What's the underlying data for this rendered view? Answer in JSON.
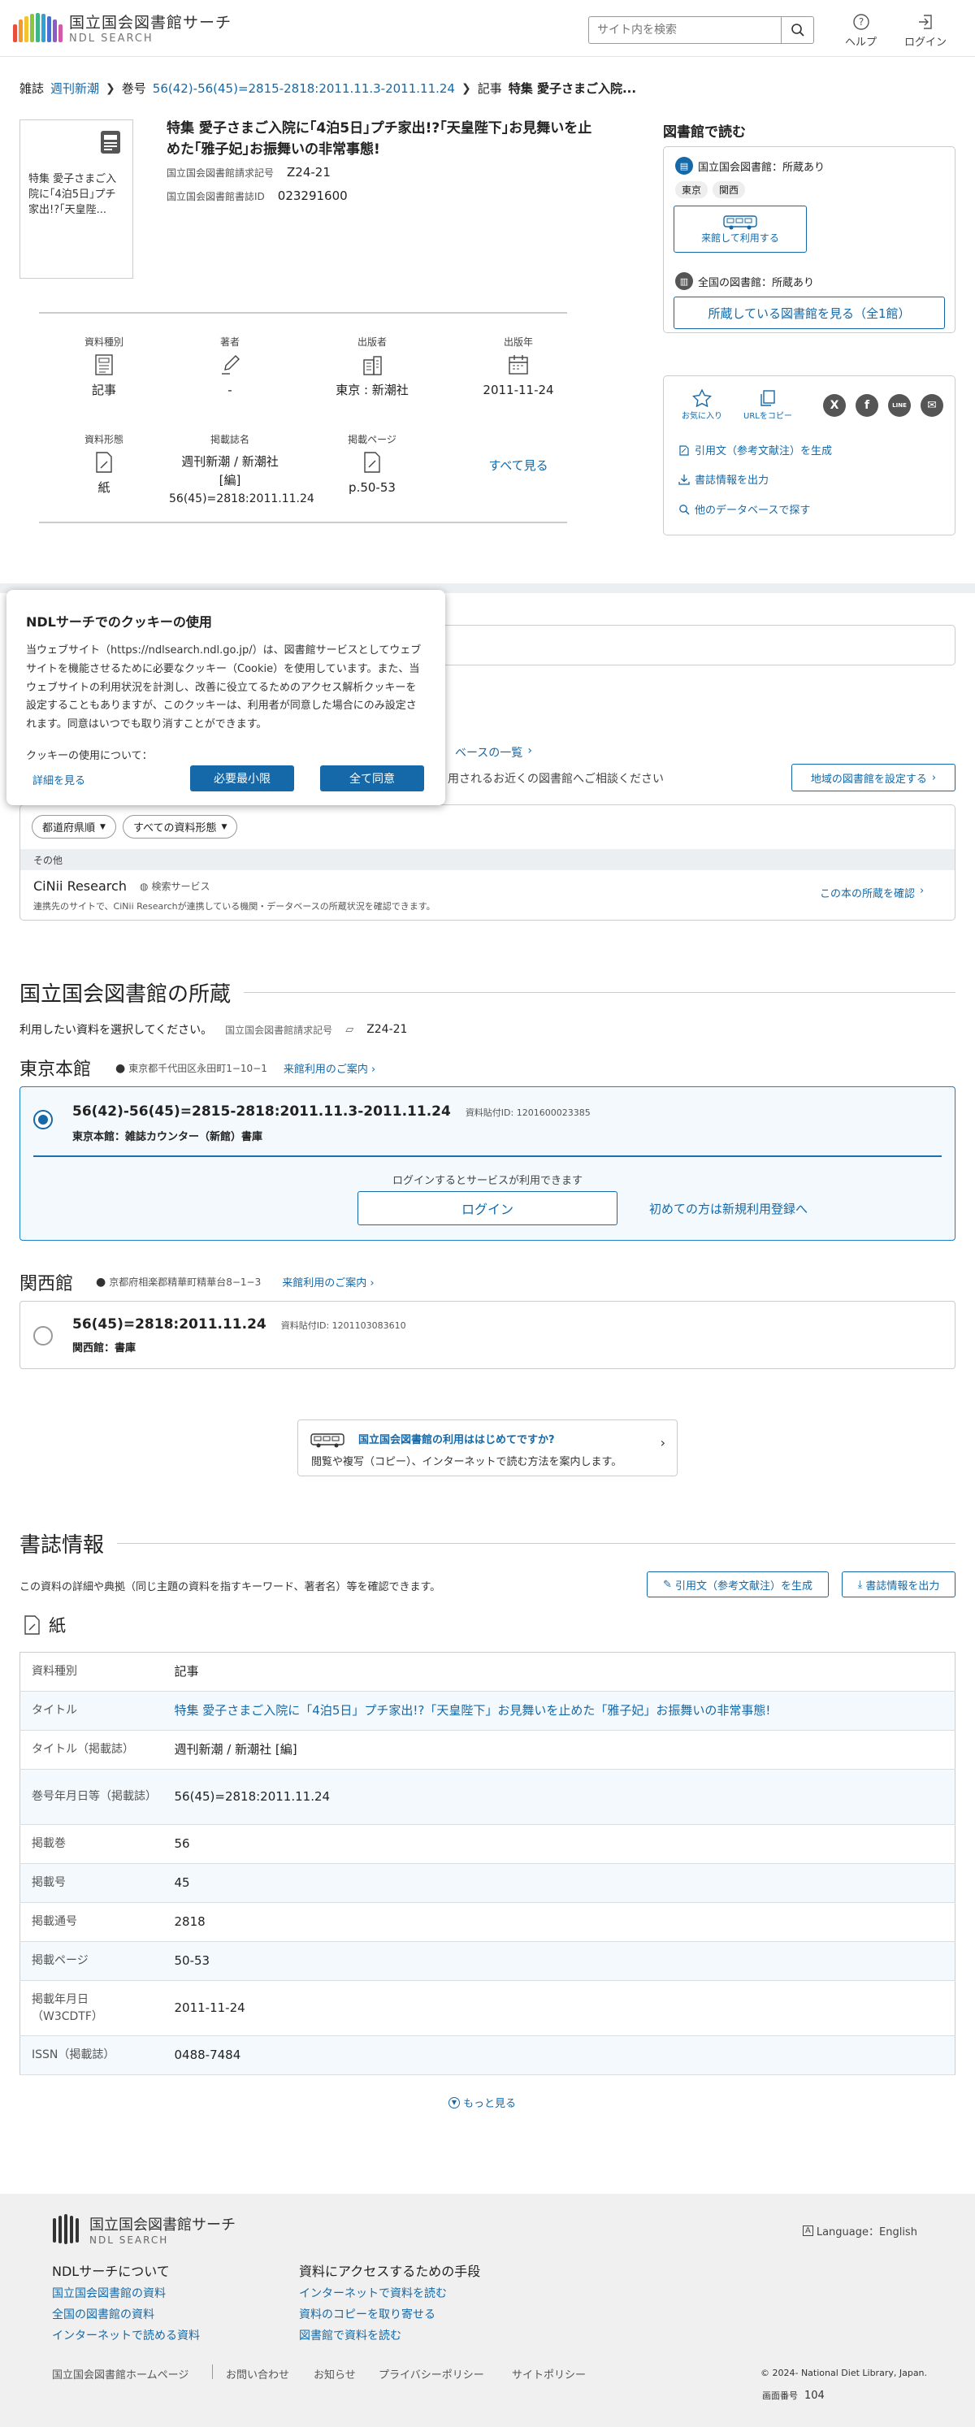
{
  "header": {
    "logo_title": "国立国会図書館サーチ",
    "logo_sub": "NDL SEARCH",
    "search_placeholder": "サイト内を検索",
    "help_label": "ヘルプ",
    "login_label": "ログイン",
    "logo_colors": [
      "#e94e3c",
      "#f29a2e",
      "#f4c430",
      "#8cc63f",
      "#3eb489",
      "#2ba3d6",
      "#4a6fd1",
      "#8b5cc7",
      "#d45ca7"
    ]
  },
  "breadcrumb": {
    "l1_label": "雑誌",
    "l1_value": "週刊新潮",
    "l2_label": "巻号",
    "l2_value": "56(42)-56(45)=2815-2818:2011.11.3-2011.11.24",
    "l3_label": "記事",
    "l3_value": "特集 愛子さまご入院..."
  },
  "record": {
    "thumb_text": "特集 愛子さまご入院に｢4泊5日｣プチ家出!?｢天皇陛...",
    "title_line1": "特集 愛子さまご入院に｢4泊5日｣プチ家出!?｢天皇陛下｣お見舞いを止",
    "title_line2": "めた｢雅子妃｣お振舞いの非常事態!",
    "callno_label": "国立国会図書館請求記号",
    "callno_value": "Z24-21",
    "bibid_label": "国立国会図書館書誌ID",
    "bibid_value": "023291600"
  },
  "summary": {
    "type_label": "資料種別",
    "type_value": "記事",
    "author_label": "著者",
    "author_value": "-",
    "publisher_label": "出版者",
    "publisher_value": "東京 : 新潮社",
    "year_label": "出版年",
    "year_value": "2011-11-24",
    "form_label": "資料形態",
    "form_value": "紙",
    "journal_label": "掲載誌名",
    "journal_value1": "週刊新潮 / 新潮社 [編]",
    "journal_value2": "56(45)=2818:2011.11.24",
    "pages_label": "掲載ページ",
    "pages_value": "p.50-53",
    "see_all": "すべて見る"
  },
  "read_panel": {
    "title": "図書館で読む",
    "ndl_label": "国立国会図書館：所蔵あり",
    "pill1": "東京",
    "pill2": "関西",
    "visit_label": "来館して利用する",
    "national_label": "全国の図書館：所蔵あり",
    "holding_button": "所蔵している図書館を見る（全1館）"
  },
  "share_panel": {
    "fav_label": "お気に入り",
    "copy_label": "URLをコピー",
    "x_label": "X",
    "fb_label": "f",
    "line_label": "LINE",
    "mail_label": "✉",
    "cite_link": "引用文（参考文献注）を生成",
    "export_link": "書誌情報を出力",
    "other_db_link": "他のデータベースで探す"
  },
  "availability": {
    "list_link": "ベースの一覧",
    "consult_text": "用されるお近くの図書館へご相談ください",
    "set_region_button": "地域の図書館を設定する",
    "filter_pref": "都道府県順",
    "filter_type": "すべての資料形態",
    "other_label": "その他",
    "cinii_name": "CiNii Research",
    "cinii_badge": "検索サービス",
    "cinii_desc": "連携先のサイトで、CiNii Researchが連携している機関・データベースの所蔵状況を確認できます。",
    "cinii_check": "この本の所蔵を確認"
  },
  "cookie": {
    "title": "NDLサーチでのクッキーの使用",
    "body": "当ウェブサイト（https://ndlsearch.ndl.go.jp/）は、図書館サービスとしてウェブサイトを機能させるために必要なクッキー（Cookie）を使用しています。また、当ウェブサイトの利用状況を計測し、改善に役立てるためのアクセス解析クッキーを設定することもありますが、このクッキーは、利用者が同意した場合にのみ設定されます。同意はいつでも取り消すことができます。",
    "question": "クッキーの使用について：",
    "detail_link": "詳細を見る",
    "min_button": "必要最小限",
    "agree_button": "全て同意"
  },
  "holdings": {
    "heading": "国立国会図書館の所蔵",
    "instruction": "利用したい資料を選択してください。",
    "callno_label": "国立国会図書館請求記号",
    "callno_value": "Z24-21",
    "tokyo_name": "東京本館",
    "tokyo_addr": "東京都千代田区永田町1−10−1",
    "visit_guide": "来館利用のご案内",
    "tokyo_item": "56(42)-56(45)=2815-2818:2011.11.3-2011.11.24",
    "tokyo_idlabel": "資料貼付ID: 1201600023385",
    "tokyo_loc": "東京本館：雑誌カウンター（新館）書庫",
    "login_prompt": "ログインするとサービスが利用できます",
    "login_button": "ログイン",
    "register_link": "初めての方は新規利用登録へ",
    "kansai_name": "関西館",
    "kansai_addr": "京都府相楽郡精華町精華台8−1−3",
    "kansai_item": "56(45)=2818:2011.11.24",
    "kansai_idlabel": "資料貼付ID: 1201103083610",
    "kansai_loc": "関西館：書庫",
    "first_time_title": "国立国会図書館の利用ははじめてですか?",
    "first_time_desc": "閲覧や複写（コピー）、インターネットで読む方法を案内します。"
  },
  "bib": {
    "heading": "書誌情報",
    "desc": "この資料の詳細や典拠（同じ主題の資料を指すキーワード、著者名）等を確認できます。",
    "cite_button": "引用文（参考文献注）を生成",
    "export_button": "書誌情報を出力",
    "form_heading": "紙",
    "rows": [
      {
        "k": "資料種別",
        "v": "記事"
      },
      {
        "k": "タイトル",
        "v": "特集 愛子さまご入院に「4泊5日」プチ家出!?「天皇陛下」お見舞いを止めた「雅子妃」お振舞いの非常事態!"
      },
      {
        "k": "タイトル（掲載誌）",
        "v": "週刊新潮 / 新潮社 [編]"
      },
      {
        "k": "巻号年月日等（掲載誌）",
        "v": "56(45)=2818:2011.11.24"
      },
      {
        "k": "掲載巻",
        "v": "56"
      },
      {
        "k": "掲載号",
        "v": "45"
      },
      {
        "k": "掲載通号",
        "v": "2818"
      },
      {
        "k": "掲載ページ",
        "v": "50-53"
      },
      {
        "k": "掲載年月日（W3CDTF）",
        "v": "2011-11-24"
      },
      {
        "k": "ISSN（掲載誌）",
        "v": "0488-7484"
      }
    ],
    "more_label": "もっと見る"
  },
  "footer": {
    "logo_title": "国立国会図書館サーチ",
    "logo_sub": "NDL SEARCH",
    "language": "Language：English",
    "about_heading": "NDLサーチについて",
    "about_links": [
      "国立国会図書館の資料",
      "全国の図書館の資料",
      "インターネットで読める資料"
    ],
    "access_heading": "資料にアクセスするための手段",
    "access_links": [
      "インターネットで資料を読む",
      "資料のコピーを取り寄せる",
      "図書館で資料を読む"
    ],
    "bottom_links": [
      "国立国会図書館ホームページ",
      "お問い合わせ",
      "お知らせ",
      "プライバシーポリシー",
      "サイトポリシー"
    ],
    "copyright": "© 2024- National Diet Library, Japan.",
    "screen_no_label": "画面番号",
    "screen_no": "104"
  }
}
